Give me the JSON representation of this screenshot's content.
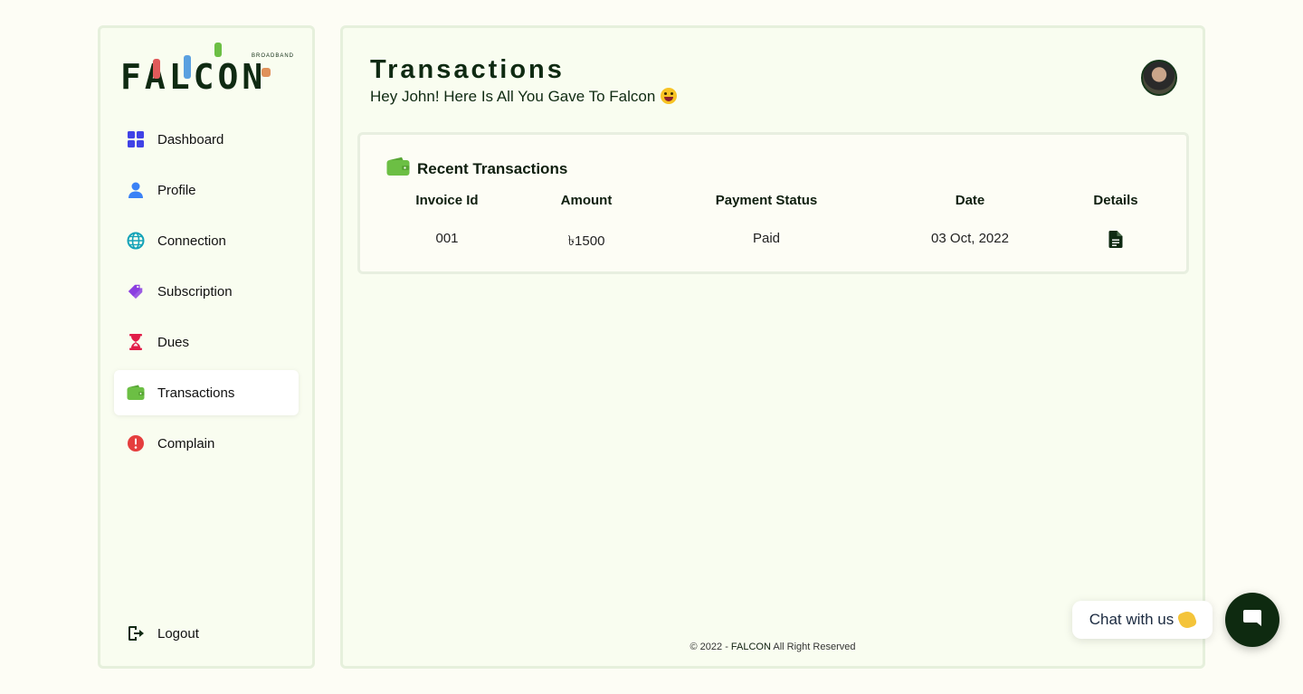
{
  "brand": {
    "logo_text": "FALCON",
    "logo_sub": "BROADBAND"
  },
  "sidebar": {
    "items": [
      {
        "label": "Dashboard",
        "icon": "grid-icon",
        "color": "#4042e6",
        "active": false
      },
      {
        "label": "Profile",
        "icon": "user-icon",
        "color": "#3b82f6",
        "active": false
      },
      {
        "label": "Connection",
        "icon": "globe-icon",
        "color": "#14a3b8",
        "active": false
      },
      {
        "label": "Subscription",
        "icon": "tags-icon",
        "color": "#8b3ee0",
        "active": false
      },
      {
        "label": "Dues",
        "icon": "hourglass-icon",
        "color": "#e11d48",
        "active": false
      },
      {
        "label": "Transactions",
        "icon": "wallet-icon",
        "color": "#6cbf44",
        "active": true
      },
      {
        "label": "Complain",
        "icon": "alert-icon",
        "color": "#e53e3e",
        "active": false
      }
    ],
    "logout_label": "Logout"
  },
  "header": {
    "title": "Transactions",
    "subtitle": "Hey John! Here Is All You Gave To Falcon"
  },
  "transactions": {
    "title": "Recent Transactions",
    "columns": [
      "Invoice Id",
      "Amount",
      "Payment Status",
      "Date",
      "Details"
    ],
    "rows": [
      {
        "invoice_id": "001",
        "amount": "৳1500",
        "status": "Paid",
        "date": "03 Oct, 2022",
        "details_icon": "document-icon"
      }
    ]
  },
  "footer": {
    "prefix": "© 2022 - ",
    "brand": "FALCON",
    "suffix": " All Right Reserved"
  },
  "chat": {
    "label": "Chat with us"
  },
  "colors": {
    "accent_dark": "#0e2a10",
    "active_wallet": "#6cbf44",
    "panel_bg": "#f9fdf0"
  }
}
